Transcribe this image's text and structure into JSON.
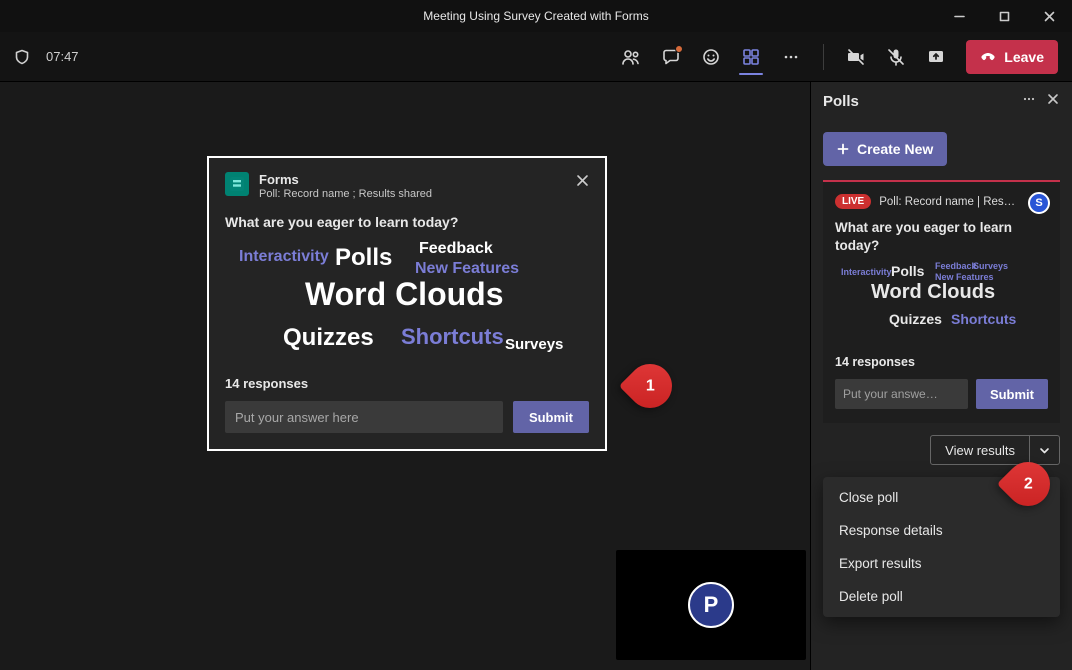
{
  "window": {
    "title": "Meeting Using Survey Created with Forms"
  },
  "meeting": {
    "timer": "07:47",
    "leave_label": "Leave"
  },
  "forms_card": {
    "app_name": "Forms",
    "subtitle": "Poll: Record name ; Results shared",
    "question": "What are you eager to learn today?",
    "responses_label": "14 responses",
    "input_placeholder": "Put your answer here",
    "submit_label": "Submit",
    "words": {
      "interactivity": "Interactivity",
      "polls": "Polls",
      "feedback": "Feedback",
      "new_features": "New Features",
      "word_clouds": "Word Clouds",
      "quizzes": "Quizzes",
      "shortcuts": "Shortcuts",
      "surveys": "Surveys"
    }
  },
  "callouts": {
    "one": "1",
    "two": "2"
  },
  "avatar": {
    "initial": "P"
  },
  "side": {
    "title": "Polls",
    "create_label": "Create New",
    "poll": {
      "live_label": "LIVE",
      "meta": "Poll: Record name | Results s…",
      "user_initial": "S",
      "question": "What are you eager to learn today?",
      "responses_label": "14 responses",
      "input_placeholder": "Put your answe…",
      "submit_label": "Submit",
      "words": {
        "interactivity": "Interactivity",
        "polls": "Polls",
        "feedback": "Feedback",
        "surveys": "Surveys",
        "new_features": "New Features",
        "word_clouds": "Word Clouds",
        "quizzes": "Quizzes",
        "shortcuts": "Shortcuts"
      }
    },
    "view_results_label": "View results",
    "menu": {
      "close_poll": "Close poll",
      "response_details": "Response details",
      "export_results": "Export results",
      "delete_poll": "Delete poll"
    }
  }
}
